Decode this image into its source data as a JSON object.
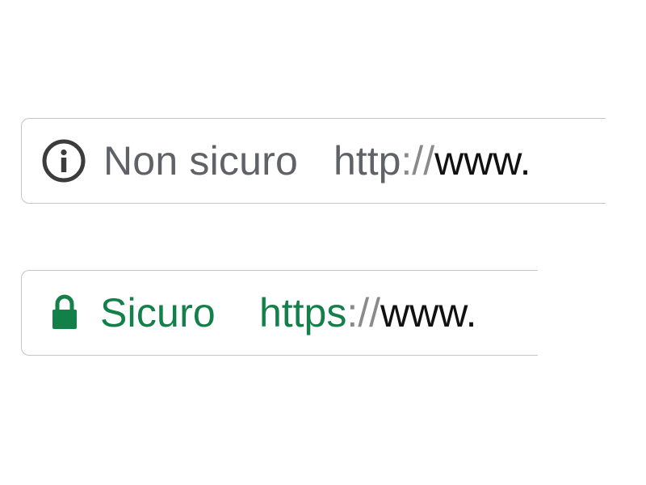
{
  "omnibox_insecure": {
    "icon": "info-circle-icon",
    "status_label": "Non sicuro",
    "url_scheme": "http",
    "url_separator": "://",
    "url_host": "www.",
    "status_color": "#5f6368"
  },
  "omnibox_secure": {
    "icon": "lock-icon",
    "status_label": "Sicuro",
    "url_scheme": "https",
    "url_separator": "://",
    "url_host": "www.",
    "status_color": "#13804a"
  }
}
